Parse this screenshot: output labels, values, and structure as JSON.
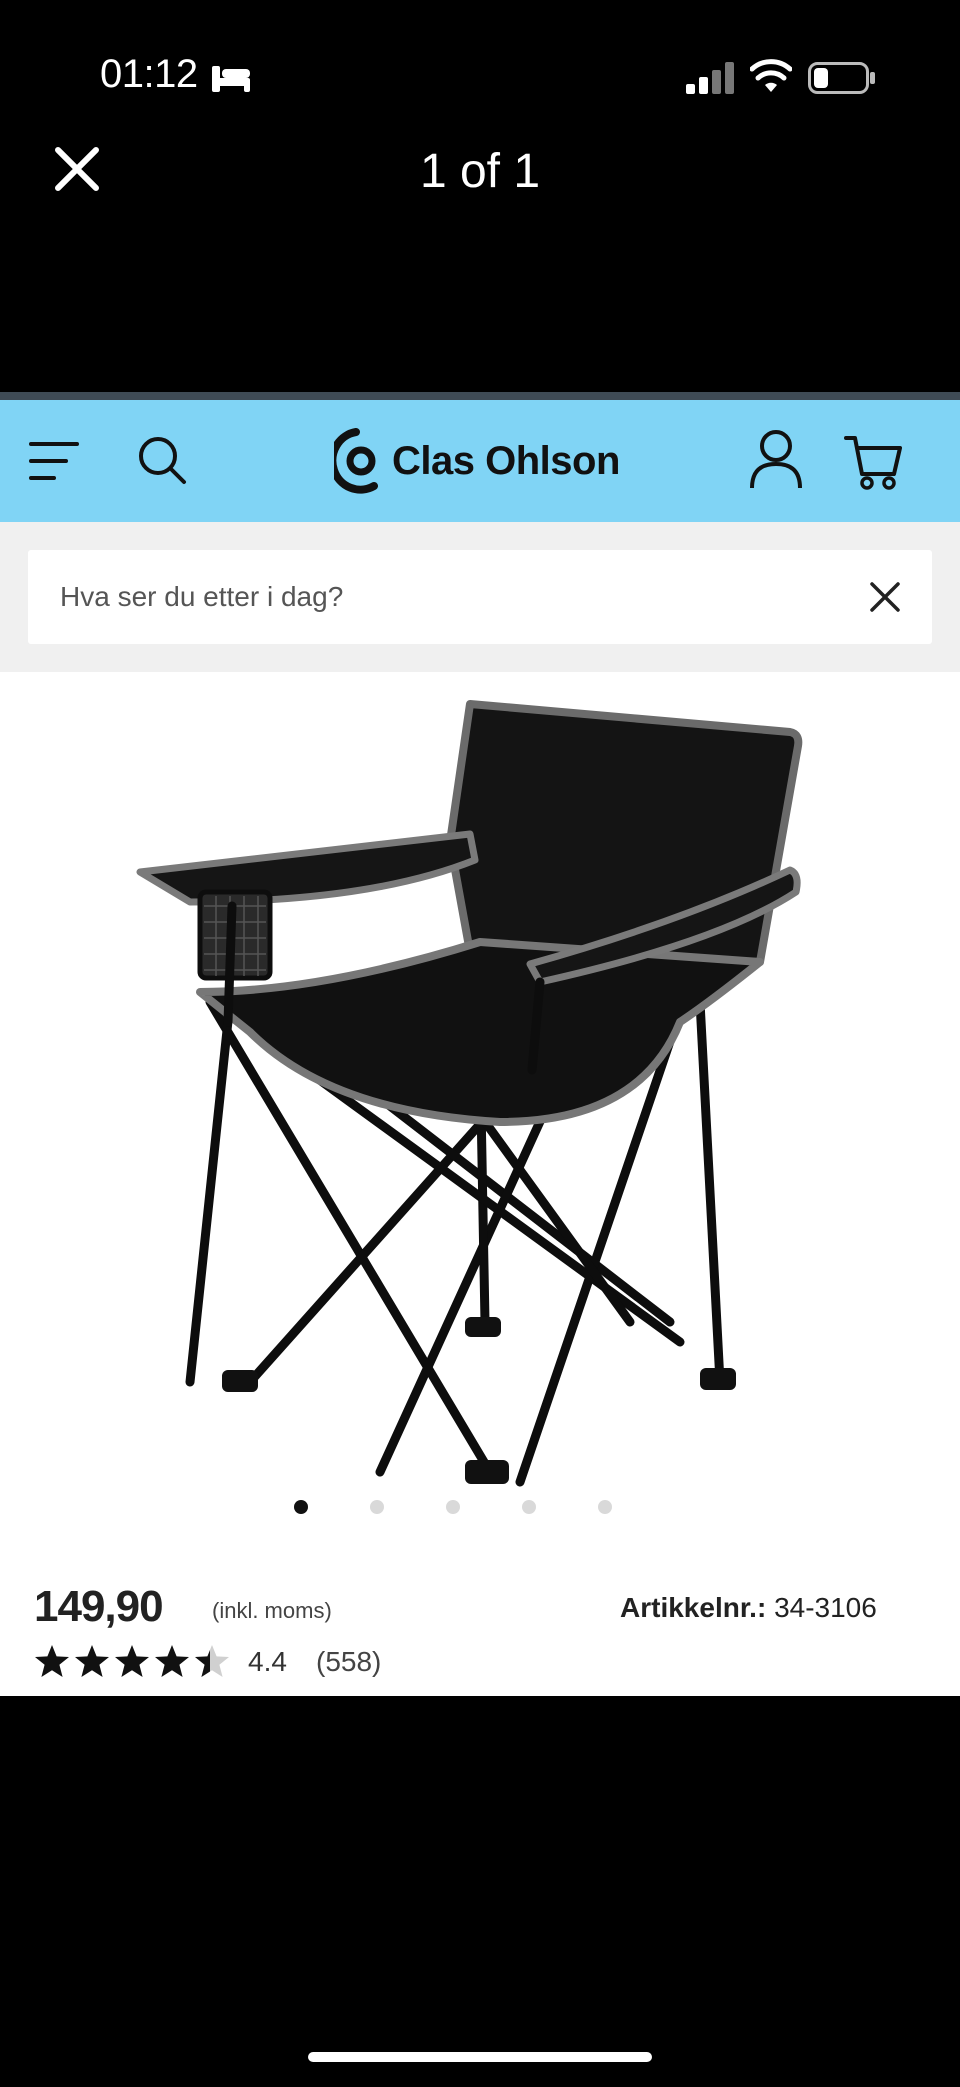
{
  "status_bar": {
    "time": "01:12",
    "icons": [
      "bed-icon",
      "cellular-signal-icon",
      "wifi-icon",
      "battery-icon"
    ]
  },
  "viewer": {
    "title": "1 of 1",
    "close_icon": "close-icon"
  },
  "header": {
    "brand": "Clas Ohlson",
    "background_color": "#80d4f5",
    "icons": [
      "hamburger-menu-icon",
      "search-icon",
      "brand-logo",
      "user-icon",
      "cart-icon"
    ]
  },
  "search": {
    "placeholder": "Hva ser du etter i dag?",
    "value": ""
  },
  "gallery": {
    "image": "folding-camping-chair",
    "dot_count": 5,
    "active_dot": 1
  },
  "product": {
    "price": "149,90",
    "price_note": "(inkl. moms)",
    "sku_label": "Artikkelnr.:",
    "sku_value": "34-3106",
    "rating": "4.4",
    "rating_value": 4.4,
    "rating_max": 5,
    "reviews": "(558)"
  }
}
